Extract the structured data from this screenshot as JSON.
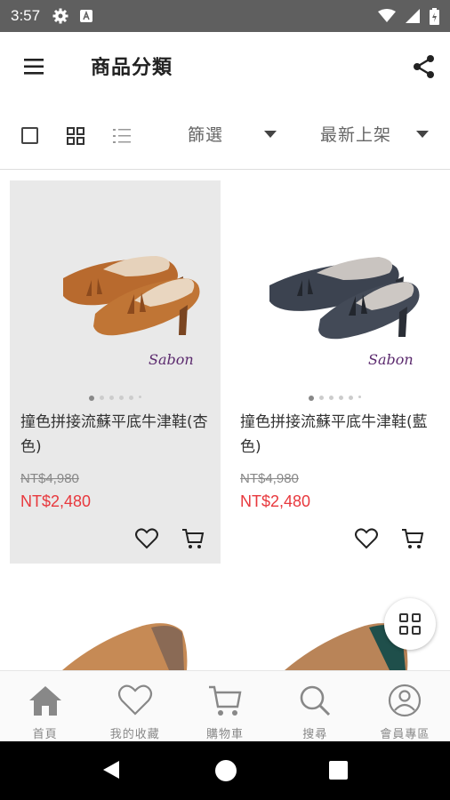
{
  "status_bar": {
    "time": "3:57"
  },
  "app_bar": {
    "title": "商品分類"
  },
  "toolbar": {
    "filter_label": "篩選",
    "sort_label": "最新上架"
  },
  "products": [
    {
      "name": "撞色拼接流蘇平底牛津鞋(杏色)",
      "old_price": "NT$4,980",
      "price": "NT$2,480",
      "brand": "Sabon",
      "dots_total": 6,
      "dots_active": 1
    },
    {
      "name": "撞色拼接流蘇平底牛津鞋(藍色)",
      "old_price": "NT$4,980",
      "price": "NT$2,480",
      "brand": "Sabon",
      "dots_total": 6,
      "dots_active": 1
    }
  ],
  "bottom_nav": [
    {
      "label": "首頁",
      "icon": "home-icon"
    },
    {
      "label": "我的收藏",
      "icon": "heart-icon"
    },
    {
      "label": "購物車",
      "icon": "cart-icon"
    },
    {
      "label": "搜尋",
      "icon": "search-icon"
    },
    {
      "label": "會員專區",
      "icon": "user-icon"
    }
  ],
  "colors": {
    "sale": "#e8383d",
    "status_bar": "#5f5f5f",
    "brand_text": "#5b2a6e"
  }
}
